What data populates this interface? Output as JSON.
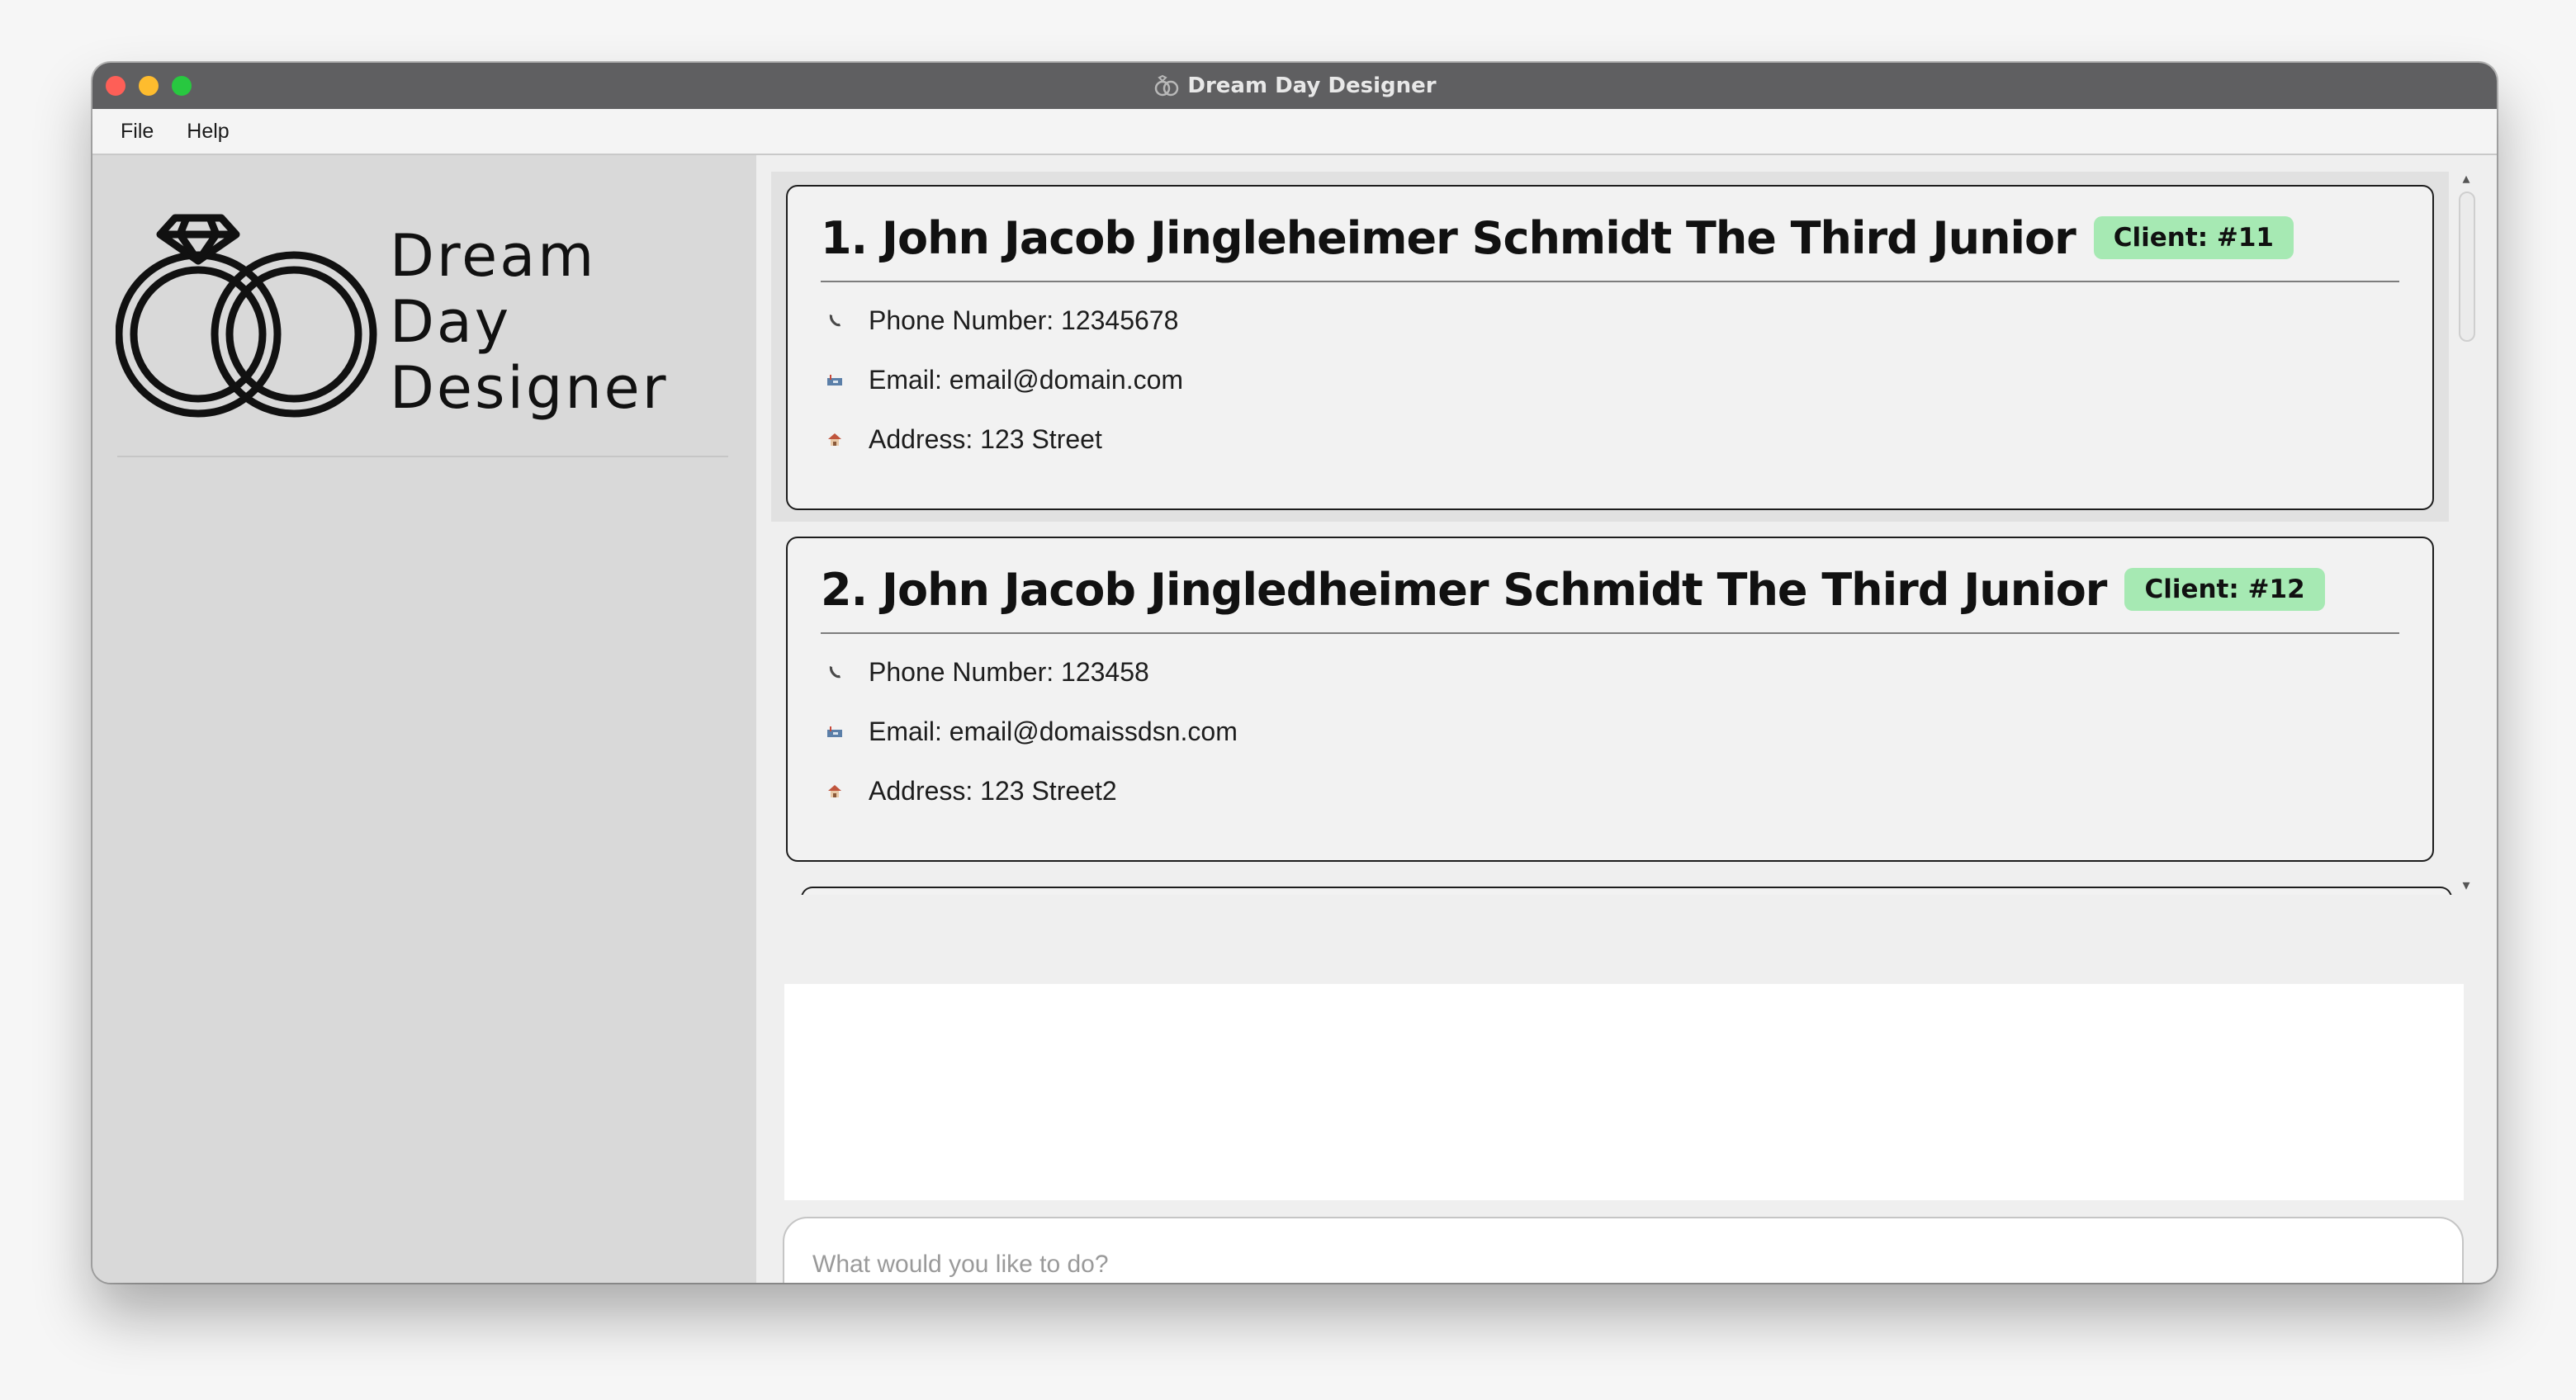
{
  "window": {
    "title": "Dream Day Designer",
    "title_icon": "rings-icon"
  },
  "menu": {
    "items": [
      {
        "label": "File"
      },
      {
        "label": "Help"
      }
    ]
  },
  "sidebar": {
    "brand_lines": [
      "Dream",
      "Day",
      "Designer"
    ],
    "logo_icon": "wedding-rings-logo"
  },
  "clients": [
    {
      "name": "1. John Jacob Jingleheimer Schmidt The Third Junior",
      "badge": "Client: #11",
      "phone": "Phone Number: 12345678",
      "email": "Email: email@domain.com",
      "address": "Address: 123 Street",
      "selected": true
    },
    {
      "name": "2. John Jacob Jingledheimer Schmidt The Third Junior",
      "badge": "Client: #12",
      "phone": "Phone Number: 123458",
      "email": "Email: email@domaissdsn.com",
      "address": "Address: 123 Street2",
      "selected": false
    }
  ],
  "icons": {
    "phone": "phone-icon",
    "email": "mailbox-icon",
    "address": "house-icon"
  },
  "result_display": {
    "text": ""
  },
  "command_box": {
    "placeholder": "What would you like to do?",
    "value": ""
  },
  "colors": {
    "badge_bg": "#a6e9b3",
    "titlebar": "#5f5f61",
    "sidebar_bg": "#d9d9d9"
  }
}
